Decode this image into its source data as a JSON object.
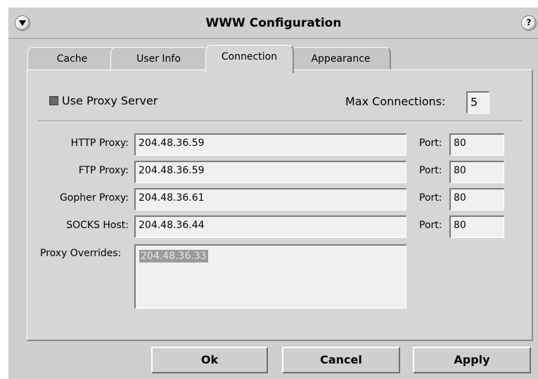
{
  "window": {
    "title": "WWW Configuration",
    "help_glyph": "?"
  },
  "tabs": [
    {
      "label": "Cache"
    },
    {
      "label": "User Info"
    },
    {
      "label": "Connection"
    },
    {
      "label": "Appearance"
    }
  ],
  "active_tab": "Connection",
  "connection": {
    "use_proxy_label": "Use Proxy Server",
    "use_proxy_checked": true,
    "max_connections_label": "Max Connections:",
    "max_connections_value": "5",
    "proxies": [
      {
        "label": "HTTP Proxy:",
        "value": "204.48.36.59",
        "port_label": "Port:",
        "port": "80"
      },
      {
        "label": "FTP Proxy:",
        "value": "204.48.36.59",
        "port_label": "Port:",
        "port": "80"
      },
      {
        "label": "Gopher Proxy:",
        "value": "204.48.36.61",
        "port_label": "Port:",
        "port": "80"
      },
      {
        "label": "SOCKS Host:",
        "value": "204.48.36.44",
        "port_label": "Port:",
        "port": "80"
      }
    ],
    "overrides_label": "Proxy Overrides:",
    "overrides_value": "204.48.36.33"
  },
  "buttons": {
    "ok": "Ok",
    "cancel": "Cancel",
    "apply": "Apply"
  },
  "icons": {
    "window_menu": "window-menu-icon",
    "help": "help-icon"
  }
}
